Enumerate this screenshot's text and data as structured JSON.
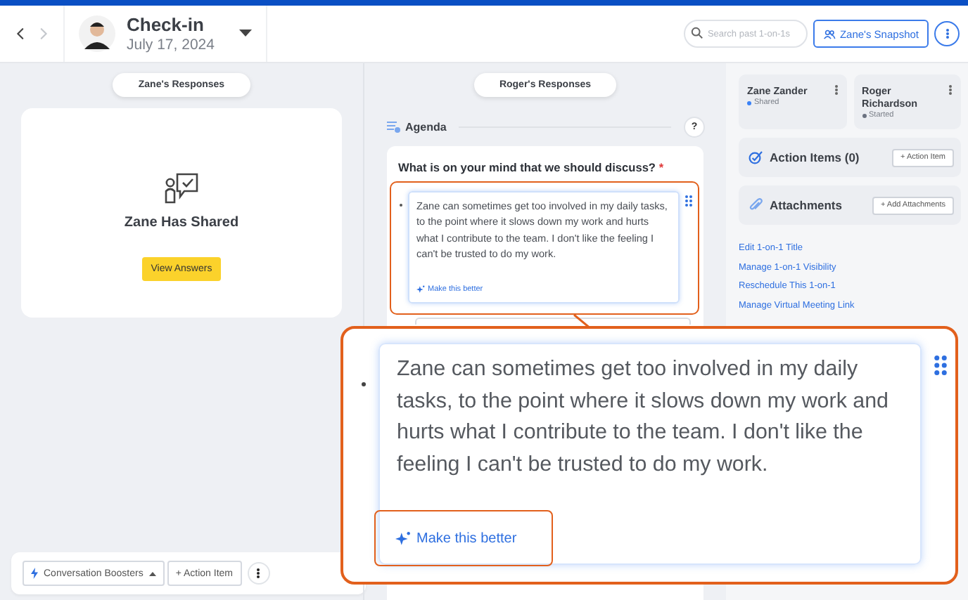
{
  "header": {
    "nav": [
      {
        "kind": "back",
        "disabled": false
      },
      {
        "kind": "forward",
        "disabled": true
      }
    ],
    "title": "Check-in",
    "date": "July 17, 2024",
    "search": {
      "placeholder": "Search past 1-on-1s"
    },
    "snapshot_button": "Zane's Snapshot"
  },
  "left": {
    "pill": "Zane's Responses",
    "card_title": "Zane Has Shared",
    "card_button": "View Answers"
  },
  "toolbar": {
    "boosters": "Conversation Boosters",
    "action": "+ Action Item"
  },
  "middle": {
    "pill": "Roger's Responses",
    "section": "Agenda",
    "help": "?",
    "question": "What is on your mind that we should discuss?",
    "required": "*",
    "answer": "Zane can sometimes get too involved in my daily tasks, to the point where it slows down my work and hurts what I contribute to the team. I don't like the feeling I can't be trusted to do my work.",
    "improve": "Make this better"
  },
  "participants": [
    {
      "name": "Zane Zander",
      "status": "Shared",
      "color": "#3b82f6"
    },
    {
      "name": "Roger Richardson",
      "status": "Started",
      "color": "#6b7280"
    }
  ],
  "action_items": {
    "title": "Action Items (0)",
    "button": "+ Action Item"
  },
  "attachments": {
    "title": "Attachments",
    "button": "+ Add Attachments"
  },
  "links": [
    "Edit 1-on-1 Title",
    "Manage 1-on-1 Visibility",
    "Reschedule This 1-on-1",
    "Manage Virtual Meeting Link"
  ],
  "callout": {
    "answer": "Zane can sometimes get too involved in my daily tasks, to the point where it slows down my work and hurts what I contribute to the team. I don't like the feeling I can't be trusted to do my work.",
    "improve": "Make this better"
  }
}
